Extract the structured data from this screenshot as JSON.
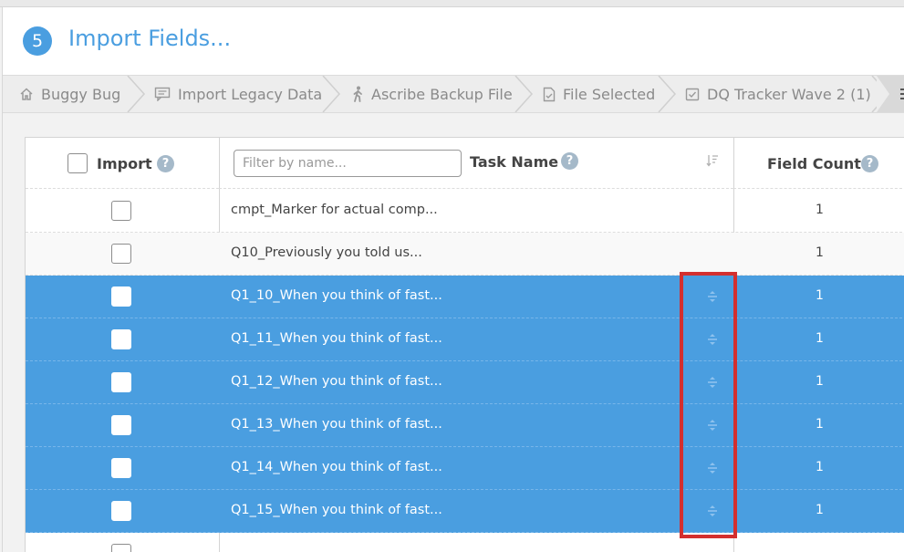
{
  "step": {
    "number": "5",
    "title": "Import Fields..."
  },
  "breadcrumbs": [
    {
      "label": "Buggy Bug",
      "icon": "home-icon"
    },
    {
      "label": "Import Legacy Data",
      "icon": "message-icon"
    },
    {
      "label": "Ascribe Backup File",
      "icon": "walking-person-icon"
    },
    {
      "label": "File Selected",
      "icon": "file-check-icon"
    },
    {
      "label": "DQ Tracker Wave 2 (1)",
      "icon": "checkbox-icon"
    }
  ],
  "table": {
    "headers": {
      "import": "Import",
      "task_name": "Task Name",
      "field_count": "Field Count"
    },
    "filter_placeholder": "Filter by name...",
    "rows": [
      {
        "name": "cmpt_Marker for actual comp...",
        "count": "1",
        "selected": false
      },
      {
        "name": "Q10_Previously you told us...",
        "count": "1",
        "selected": false
      },
      {
        "name": "Q1_10_When you think of fast...",
        "count": "1",
        "selected": true
      },
      {
        "name": "Q1_11_When you think of fast...",
        "count": "1",
        "selected": true
      },
      {
        "name": "Q1_12_When you think of fast...",
        "count": "1",
        "selected": true
      },
      {
        "name": "Q1_13_When you think of fast...",
        "count": "1",
        "selected": true
      },
      {
        "name": "Q1_14_When you think of fast...",
        "count": "1",
        "selected": true
      },
      {
        "name": "Q1_15_When you think of fast...",
        "count": "1",
        "selected": true
      }
    ]
  },
  "colors": {
    "accent": "#4a9ee0",
    "highlight_box": "#d32f2f"
  }
}
